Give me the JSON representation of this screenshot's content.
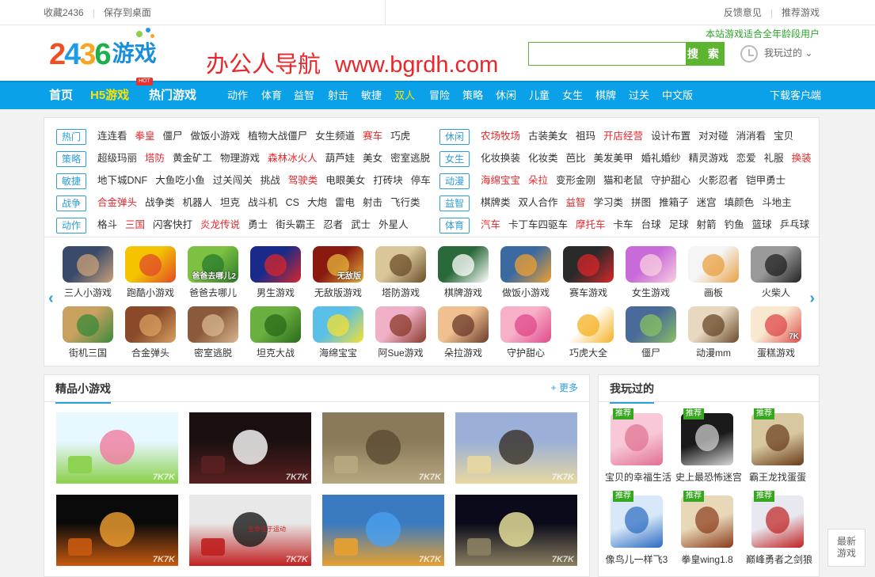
{
  "topbar": {
    "bookmark": "收藏2436",
    "save_desktop": "保存到桌面",
    "feedback": "反馈意见",
    "recommend": "推荐游戏"
  },
  "header": {
    "banner_text": "办公人导航",
    "banner_url": "www.bgrdh.com",
    "age_hint": "本站游戏适合全年龄段用户",
    "search_button": "搜 索",
    "search_placeholder": "",
    "played_label": "我玩过的"
  },
  "nav": {
    "items": [
      "首页",
      "H5游戏",
      "热门游戏",
      "动作",
      "体育",
      "益智",
      "射击",
      "敏捷",
      "双人",
      "冒险",
      "策略",
      "休闲",
      "儿童",
      "女生",
      "棋牌",
      "过关",
      "中文版"
    ],
    "hot_badge": "HOT",
    "download": "下载客户端"
  },
  "categories_left": [
    {
      "tag": "热门",
      "links": [
        {
          "t": "连连看"
        },
        {
          "t": "拳皇",
          "red": true
        },
        {
          "t": "僵尸"
        },
        {
          "t": "做饭小游戏"
        },
        {
          "t": "植物大战僵尸"
        },
        {
          "t": "女生频道"
        },
        {
          "t": "赛车",
          "red": true
        },
        {
          "t": "巧虎"
        }
      ]
    },
    {
      "tag": "策略",
      "links": [
        {
          "t": "超级玛丽"
        },
        {
          "t": "塔防",
          "red": true
        },
        {
          "t": "黄金矿工"
        },
        {
          "t": "物理游戏"
        },
        {
          "t": "森林冰火人",
          "red": true
        },
        {
          "t": "葫芦娃"
        },
        {
          "t": "美女"
        },
        {
          "t": "密室逃脱"
        }
      ]
    },
    {
      "tag": "敏捷",
      "links": [
        {
          "t": "地下城DNF"
        },
        {
          "t": "大鱼吃小鱼"
        },
        {
          "t": "过关闯关"
        },
        {
          "t": "挑战"
        },
        {
          "t": "驾驶类",
          "red": true
        },
        {
          "t": "电眼美女"
        },
        {
          "t": "打砖块"
        },
        {
          "t": "停车"
        }
      ]
    },
    {
      "tag": "战争",
      "links": [
        {
          "t": "合金弹头",
          "red": true
        },
        {
          "t": "战争类"
        },
        {
          "t": "机器人"
        },
        {
          "t": "坦克"
        },
        {
          "t": "战斗机"
        },
        {
          "t": "CS"
        },
        {
          "t": "大炮"
        },
        {
          "t": "雷电"
        },
        {
          "t": "射击"
        },
        {
          "t": "飞行类"
        }
      ]
    },
    {
      "tag": "动作",
      "links": [
        {
          "t": "格斗"
        },
        {
          "t": "三国",
          "red": true
        },
        {
          "t": "闪客快打"
        },
        {
          "t": "炎龙传说",
          "red": true
        },
        {
          "t": "勇士"
        },
        {
          "t": "街头霸王"
        },
        {
          "t": "忍者"
        },
        {
          "t": "武士"
        },
        {
          "t": "外星人"
        }
      ]
    }
  ],
  "categories_right": [
    {
      "tag": "休闲",
      "links": [
        {
          "t": "农场牧场",
          "red": true
        },
        {
          "t": "古装美女"
        },
        {
          "t": "祖玛"
        },
        {
          "t": "开店经营",
          "red": true
        },
        {
          "t": "设计布置"
        },
        {
          "t": "对对碰"
        },
        {
          "t": "消消看"
        },
        {
          "t": "宝贝"
        }
      ]
    },
    {
      "tag": "女生",
      "links": [
        {
          "t": "化妆换装"
        },
        {
          "t": "化妆类"
        },
        {
          "t": "芭比"
        },
        {
          "t": "美发美甲"
        },
        {
          "t": "婚礼婚纱"
        },
        {
          "t": "精灵游戏"
        },
        {
          "t": "恋爱"
        },
        {
          "t": "礼服"
        },
        {
          "t": "换装",
          "red": true
        }
      ]
    },
    {
      "tag": "动漫",
      "links": [
        {
          "t": "海绵宝宝",
          "red": true
        },
        {
          "t": "朵拉",
          "red": true
        },
        {
          "t": "变形金刚"
        },
        {
          "t": "猫和老鼠"
        },
        {
          "t": "守护甜心"
        },
        {
          "t": "火影忍者"
        },
        {
          "t": "铠甲勇士"
        }
      ]
    },
    {
      "tag": "益智",
      "links": [
        {
          "t": "棋牌类"
        },
        {
          "t": "双人合作"
        },
        {
          "t": "益智",
          "red": true
        },
        {
          "t": "学习类"
        },
        {
          "t": "拼图"
        },
        {
          "t": "推箱子"
        },
        {
          "t": "迷宫"
        },
        {
          "t": "填颜色"
        },
        {
          "t": "斗地主"
        }
      ]
    },
    {
      "tag": "体育",
      "links": [
        {
          "t": "汽车",
          "red": true
        },
        {
          "t": "卡丁车四驱车"
        },
        {
          "t": "摩托车",
          "red": true
        },
        {
          "t": "卡车"
        },
        {
          "t": "台球"
        },
        {
          "t": "足球"
        },
        {
          "t": "射箭"
        },
        {
          "t": "钓鱼"
        },
        {
          "t": "篮球"
        },
        {
          "t": "乒乓球"
        }
      ]
    }
  ],
  "tiles_row1": [
    {
      "cap": "三人小游戏",
      "c1": "#3a4a6a",
      "c2": "#c9a27a"
    },
    {
      "cap": "跑酷小游戏",
      "c1": "#f5c400",
      "c2": "#e14a2a"
    },
    {
      "cap": "爸爸去哪儿",
      "c1": "#7cc142",
      "c2": "#2a7a2a",
      "txt": "爸爸去哪儿2"
    },
    {
      "cap": "男生游戏",
      "c1": "#1a2a8a",
      "c2": "#d8262a"
    },
    {
      "cap": "无敌版游戏",
      "c1": "#8a1a10",
      "c2": "#e6b43a",
      "txt": "无敌版"
    },
    {
      "cap": "塔防游戏",
      "c1": "#d9c79a",
      "c2": "#6b4e2a"
    },
    {
      "cap": "棋牌游戏",
      "c1": "#2a6a3a",
      "c2": "#ffffff"
    },
    {
      "cap": "做饭小游戏",
      "c1": "#3a6aa0",
      "c2": "#f0a030"
    },
    {
      "cap": "赛车游戏",
      "c1": "#2a2a2a",
      "c2": "#d8262a"
    },
    {
      "cap": "女生游戏",
      "c1": "#c86ad8",
      "c2": "#f8d0e0"
    },
    {
      "cap": "画板",
      "c1": "#f5f5f5",
      "c2": "#e8a040"
    },
    {
      "cap": "火柴人",
      "c1": "#9a9a9a",
      "c2": "#222222"
    }
  ],
  "tiles_row2": [
    {
      "cap": "街机三国",
      "c1": "#c8a060",
      "c2": "#3a8a3a"
    },
    {
      "cap": "合金弹头",
      "c1": "#8a4a2a",
      "c2": "#d8a060"
    },
    {
      "cap": "密室逃脱",
      "c1": "#8a5a3a",
      "c2": "#d8b890"
    },
    {
      "cap": "坦克大战",
      "c1": "#6ab040",
      "c2": "#2a6a1a"
    },
    {
      "cap": "海绵宝宝",
      "c1": "#5ac0e8",
      "c2": "#f5e030"
    },
    {
      "cap": "阿Sue游戏",
      "c1": "#f0b0c8",
      "c2": "#8a3a2a"
    },
    {
      "cap": "朵拉游戏",
      "c1": "#f0c090",
      "c2": "#6a3a2a"
    },
    {
      "cap": "守护甜心",
      "c1": "#f8b0c8",
      "c2": "#e04a8a"
    },
    {
      "cap": "巧虎大全",
      "c1": "#ffffff",
      "c2": "#f5b020"
    },
    {
      "cap": "僵尸",
      "c1": "#4a6a9a",
      "c2": "#8ac060"
    },
    {
      "cap": "动漫mm",
      "c1": "#e8d8c0",
      "c2": "#6a4a2a"
    },
    {
      "cap": "蛋糕游戏",
      "c1": "#f8e8d0",
      "c2": "#e04a4a",
      "txt": "7K"
    }
  ],
  "featured": {
    "title": "精品小游戏",
    "more": "+ 更多",
    "thumbs": [
      {
        "c1": "#e8f8ff",
        "c2": "#8ad04a",
        "c3": "#f07aa0",
        "wm": "7K7K"
      },
      {
        "c1": "#1a1010",
        "c2": "#5a2020",
        "c3": "#ffffff",
        "wm": "7K7K"
      },
      {
        "c1": "#8a7a5a",
        "c2": "#b8a880",
        "c3": "#5a4a30",
        "wm": "7K7K"
      },
      {
        "c1": "#9ab0d8",
        "c2": "#e8d8a0",
        "c3": "#3a3028",
        "wm": "7K7K"
      },
      {
        "c1": "#0a0a0a",
        "c2": "#c85a10",
        "c3": "#f0a030",
        "wm": "7K7K"
      },
      {
        "c1": "#e8e8e8",
        "c2": "#c02020",
        "c3": "#1a1a1a",
        "wm": "7K7K",
        "txt": "生命在于运动"
      },
      {
        "c1": "#3a7ac0",
        "c2": "#e8a030",
        "c3": "#4aa0f0",
        "wm": "7K7K"
      },
      {
        "c1": "#0a0a1a",
        "c2": "#8a8060",
        "c3": "#f0e8a0",
        "wm": "7K7K"
      }
    ]
  },
  "played": {
    "title": "我玩过的",
    "badge": "推荐",
    "items": [
      {
        "cap": "宝贝的幸福生活",
        "c1": "#f8c8d8",
        "c2": "#e07090"
      },
      {
        "cap": "史上最恐怖迷宫",
        "c1": "#1a1a1a",
        "c2": "#d8d8d8"
      },
      {
        "cap": "霸王龙找蛋蛋",
        "c1": "#d8c8a0",
        "c2": "#6a3a1a"
      },
      {
        "cap": "像鸟儿一样飞3",
        "c1": "#d8e8f8",
        "c2": "#2a6ac0"
      },
      {
        "cap": "拳皇wing1.8",
        "c1": "#e8d8b8",
        "c2": "#8a3a1a"
      },
      {
        "cap": "巅峰勇者之剑狼",
        "c1": "#e8e8f0",
        "c2": "#c02020"
      }
    ]
  },
  "float_btn": "最新游戏"
}
